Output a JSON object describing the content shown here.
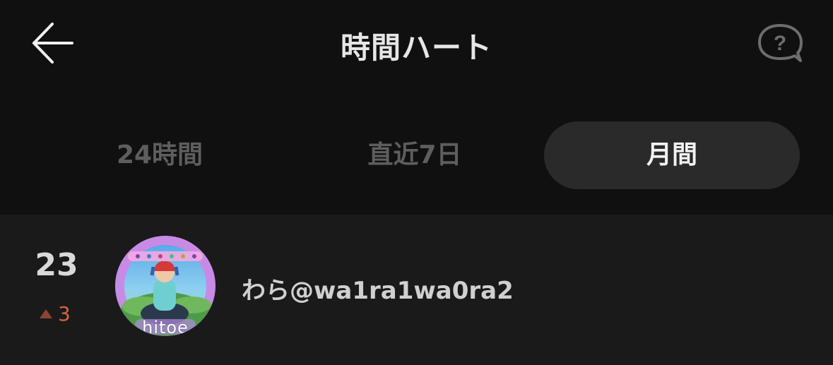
{
  "header": {
    "title": "時間ハート",
    "back_icon": "arrow-left-icon",
    "help_icon": "question-speech-bubble-icon"
  },
  "tabs": [
    {
      "label": "24時間",
      "active": false
    },
    {
      "label": "直近7日",
      "active": false
    },
    {
      "label": "月間",
      "active": true
    }
  ],
  "ranking": [
    {
      "rank": "23",
      "change": "3",
      "change_direction": "up",
      "avatar_text": "hitoe",
      "name": "わら@wa1ra1wa0ra2"
    }
  ],
  "colors": {
    "background": "#101010",
    "list_background": "#1a1a1a",
    "active_tab": "#2a2a2a",
    "rank_up": "#d7633f"
  }
}
